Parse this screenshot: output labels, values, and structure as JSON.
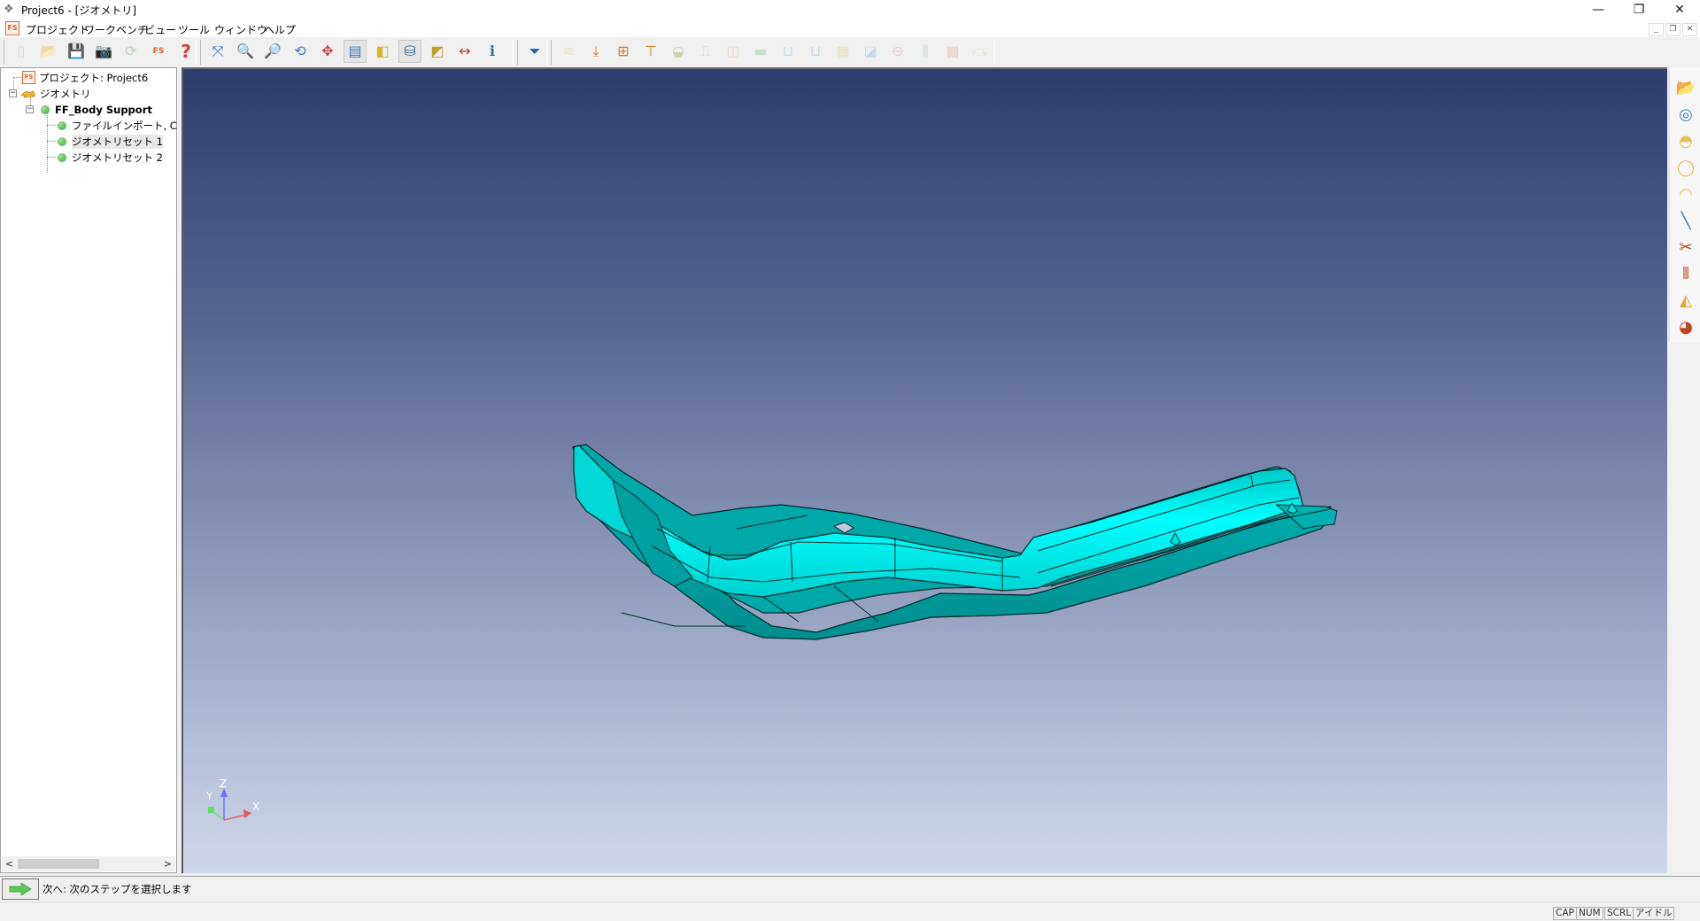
{
  "window": {
    "title": "Project6 - [ジオメトリ]",
    "controls": {
      "minimize": "—",
      "restore": "❐",
      "close": "✕"
    },
    "mdi_controls": {
      "minimize": "_",
      "restore": "❐",
      "close": "✕"
    }
  },
  "menu": {
    "logo": "FS",
    "items": [
      "プロジェクト",
      "ワークベンチ",
      "ビュー",
      "ツール",
      "ウィンドウ",
      "ヘルプ"
    ]
  },
  "toolbar": {
    "file_group": [
      {
        "icon": "new-document-icon",
        "glyph": "▯",
        "color": "#8fb7e0",
        "enabled": false
      },
      {
        "icon": "open-folder-icon",
        "glyph": "📂",
        "color": "#e8c070",
        "enabled": false
      },
      {
        "icon": "save-icon",
        "glyph": "💾",
        "color": "#2a70b8",
        "enabled": true
      },
      {
        "icon": "camera-icon",
        "glyph": "📷",
        "color": "#2a70b8",
        "enabled": true
      },
      {
        "icon": "refresh-icon",
        "glyph": "⟳",
        "color": "#50a050",
        "enabled": false
      },
      {
        "icon": "fs-report-icon",
        "glyph": "FS",
        "color": "#e06030",
        "enabled": true
      },
      {
        "icon": "help-icon",
        "glyph": "?",
        "color": "#d04040",
        "enabled": true
      }
    ],
    "view_group": [
      {
        "icon": "fit-all-icon",
        "glyph": "⤧",
        "color": "#3a7ac0",
        "pressed": false
      },
      {
        "icon": "zoom-window-icon",
        "glyph": "🔍",
        "color": "#2060b0",
        "pressed": false
      },
      {
        "icon": "zoom-in-icon",
        "glyph": "🔎",
        "color": "#2060b0",
        "pressed": false
      },
      {
        "icon": "rotate-icon",
        "glyph": "⟲",
        "color": "#3a7ac0",
        "pressed": false
      },
      {
        "icon": "pan-icon",
        "glyph": "✥",
        "color": "#d04040",
        "pressed": false
      },
      {
        "icon": "update-view-icon",
        "glyph": "▤",
        "color": "#3a7ac0",
        "pressed": true
      },
      {
        "icon": "shaded-box-icon",
        "glyph": "◧",
        "color": "#e0b030",
        "pressed": false
      },
      {
        "icon": "cylinder-icon",
        "glyph": "⛁",
        "color": "#2a6a9a",
        "pressed": true
      },
      {
        "icon": "section-plane-icon",
        "glyph": "◩",
        "color": "#c0a030",
        "pressed": false
      },
      {
        "icon": "measure-icon",
        "glyph": "↔",
        "color": "#c04020",
        "pressed": false
      },
      {
        "icon": "info-icon",
        "glyph": "ℹ",
        "color": "#2a6aa0",
        "pressed": false
      }
    ],
    "filter_group": [
      {
        "icon": "filter-icon",
        "glyph": "⏷",
        "color": "#2060b0"
      }
    ],
    "workflow_group": [
      {
        "icon": "surface-shape-icon",
        "glyph": "≋",
        "color": "#e8c070",
        "enabled": false
      },
      {
        "icon": "tool-down-wrench-icon",
        "glyph": "⤓",
        "color": "#d08020",
        "enabled": true
      },
      {
        "icon": "tool-press-wrench-icon",
        "glyph": "⊞",
        "color": "#d08020",
        "enabled": true
      },
      {
        "icon": "tool-draw-wrench-icon",
        "glyph": "⊤",
        "color": "#d08020",
        "enabled": true
      },
      {
        "icon": "formability-icon",
        "glyph": "◒",
        "color": "#80a040",
        "enabled": false
      },
      {
        "icon": "profile-icon",
        "glyph": "⎍",
        "color": "#80a0c0",
        "enabled": false
      },
      {
        "icon": "split-icon",
        "glyph": "◫",
        "color": "#e0a060",
        "enabled": false
      },
      {
        "icon": "blank-icon",
        "glyph": "▬",
        "color": "#80c080",
        "enabled": false
      },
      {
        "icon": "die-icon",
        "glyph": "⊔",
        "color": "#80b0e0",
        "enabled": false
      },
      {
        "icon": "die-set-icon",
        "glyph": "⊔",
        "color": "#80b0e0",
        "enabled": false
      },
      {
        "icon": "mesh-icon",
        "glyph": "▦",
        "color": "#e0c060",
        "enabled": false
      },
      {
        "icon": "trim-icon",
        "glyph": "◪",
        "color": "#80b0e0",
        "enabled": false
      },
      {
        "icon": "bead-icon",
        "glyph": "⊖",
        "color": "#e09080",
        "enabled": false
      },
      {
        "icon": "columns-icon",
        "glyph": "⫼",
        "color": "#80c080",
        "enabled": false
      },
      {
        "icon": "grid-icon",
        "glyph": "▩",
        "color": "#e09080",
        "enabled": false
      },
      {
        "icon": "springback-icon",
        "glyph": "⤼",
        "color": "#e0c070",
        "enabled": false
      }
    ]
  },
  "tree": {
    "items": [
      {
        "label": "プロジェクト: Project6",
        "icon": "fs-project-icon",
        "level": 0
      },
      {
        "label": "ジオメトリ",
        "icon": "geometry-folder-icon",
        "level": 0,
        "expanded": true
      },
      {
        "label": "FF_Body Support",
        "icon": "status-dot-icon",
        "level": 1,
        "expanded": true
      },
      {
        "label": "ファイルインポート, C:¥FT",
        "icon": "status-dot-icon",
        "level": 2
      },
      {
        "label": "ジオメトリセット 1",
        "icon": "status-dot-icon",
        "level": 2,
        "selected": true
      },
      {
        "label": "ジオメトリセット 2",
        "icon": "status-dot-icon",
        "level": 2
      }
    ],
    "expander_glyph": "−",
    "scroll_left": "<",
    "scroll_right": ">"
  },
  "viewport": {
    "axis_labels": {
      "x": "X",
      "y": "Y",
      "z": "Z"
    },
    "part_colors": {
      "light": "#00ffff",
      "mid": "#00d8d8",
      "dark": "#009a9a",
      "edge": "#002a2a"
    }
  },
  "right_toolbar": [
    {
      "icon": "import-geometry-icon",
      "glyph": "📂",
      "color": "#e8a030"
    },
    {
      "icon": "blank-roll-icon",
      "glyph": "◎",
      "color": "#3a8ab8"
    },
    {
      "icon": "surface-patch-icon",
      "glyph": "◓",
      "color": "#e8c050"
    },
    {
      "icon": "fill-hole-icon",
      "glyph": "◯",
      "color": "#e8c050"
    },
    {
      "icon": "edge-fill-icon",
      "glyph": "◠",
      "color": "#e8c050"
    },
    {
      "icon": "line-icon",
      "glyph": "╲",
      "color": "#3a7ab0"
    },
    {
      "icon": "cut-surface-icon",
      "glyph": "✂",
      "color": "#c04020"
    },
    {
      "icon": "symmetry-icon",
      "glyph": "⫴",
      "color": "#c04020"
    },
    {
      "icon": "reflect-icon",
      "glyph": "◭",
      "color": "#e8a030"
    },
    {
      "icon": "inspect-surface-icon",
      "glyph": "◕",
      "color": "#c04020"
    }
  ],
  "next_step": {
    "text": "次へ: 次のステップを選択します"
  },
  "status": {
    "indicators": [
      "CAP",
      "NUM",
      "SCRL",
      "アイドル"
    ]
  }
}
